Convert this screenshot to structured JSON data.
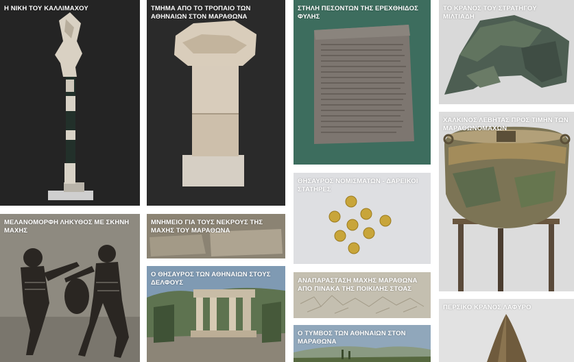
{
  "gallery": {
    "items": [
      {
        "title": "Η ΝΙΚΗ ΤΟΥ ΚΑΛΛΙΜΑΧΟΥ"
      },
      {
        "title": "ΤΜΗΜΑ ΑΠΟ ΤΟ ΤΡΟΠΑΙΟ ΤΩΝ ΑΘΗΝΑΙΩΝ ΣΤΟΝ ΜΑΡΑΘΩΝΑ"
      },
      {
        "title": "ΣΤΗΛΗ ΠΕΣΟΝΤΩΝ ΤΗΣ ΕΡΕΧΘΗΙΔΟΣ ΦΥΛΗΣ"
      },
      {
        "title": "ΤΟ ΚΡΑΝΟΣ ΤΟΥ ΣΤΡΑΤΗΓΟΥ ΜΙΛΤΙΑΔΗ"
      },
      {
        "title": "ΘΗΣΑΥΡΟΣ ΝΟΜΙΣΜΑΤΩΝ - ΔΑΡΕΙΚΟΙ ΣΤΑΤΗΡΕΣ"
      },
      {
        "title": "ΧΑΛΚΙΝΟΣ ΛΕΒΗΤΑΣ ΠΡΟΣ ΤΙΜΗΝ ΤΩΝ ΜΑΡΑΘΩΝΟΜΑΧΩΝ"
      },
      {
        "title": "ΜΕΛΑΝΟΜΟΡΦΗ ΛΗΚΥΘΟΣ ΜΕ ΣΚΗΝΗ ΜΑΧΗΣ"
      },
      {
        "title": "ΜΝΗΜΕΙΟ ΓΙΑ ΤΟΥΣ ΝΕΚΡΟΥΣ ΤΗΣ ΜΑΧΗΣ ΤΟΥ ΜΑΡΑΘΩΝΑ"
      },
      {
        "title": "Ο ΘΗΣΑΥΡΟΣ ΤΩΝ ΑΘΗΝΑΙΩΝ ΣΤΟΥΣ ΔΕΛΦΟΥΣ"
      },
      {
        "title": "ΑΝΑΠΑΡΑΣΤΑΣΗ ΜΑΧΗΣ ΜΑΡΑΘΩΝΑ ΑΠΟ ΠΙΝΑΚΑ ΤΗΣ ΠΟΙΚΙΛΗΣ ΣΤΟΑΣ"
      },
      {
        "title": "Ο ΤΥΜΒΟΣ ΤΩΝ ΑΘΗΝΑΙΩΝ ΣΤΟΝ ΜΑΡΑΘΩΝΑ"
      },
      {
        "title": "ΠΕΡΣΙΚΟ ΚΡΑΝΟΣ ΛΑΦΥΡΟ"
      }
    ]
  }
}
